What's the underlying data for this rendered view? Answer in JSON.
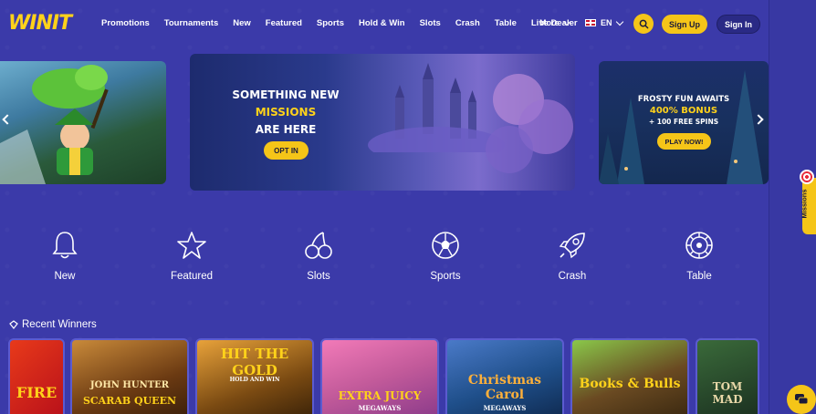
{
  "header": {
    "logo_w": "W",
    "logo_rest": "INIT",
    "nav": [
      "Promotions",
      "Tournaments",
      "New",
      "Featured",
      "Sports",
      "Hold & Win",
      "Slots",
      "Crash",
      "Table",
      "Live Dealer"
    ],
    "more_label": "More",
    "lang_label": "EN",
    "signup_label": "Sign Up",
    "signin_label": "Sign In"
  },
  "banners": {
    "middle": {
      "line1": "SOMETHING NEW",
      "line2": "MISSIONS",
      "line3": "ARE HERE",
      "button": "OPT IN"
    },
    "right": {
      "line1": "FROSTY FUN AWAITS",
      "line2": "400% BONUS",
      "line3": "+ 100 FREE SPINS",
      "button": "PLAY NOW!"
    }
  },
  "categories": [
    "New",
    "Featured",
    "Slots",
    "Sports",
    "Crash",
    "Table"
  ],
  "recent_winners": {
    "title": "Recent Winners",
    "games": [
      {
        "title": "FIRE",
        "color": "#c8161d"
      },
      {
        "title": "JOHN HUNTER",
        "subtitle": "SCARAB QUEEN",
        "color": "#6b3a12"
      },
      {
        "title": "HIT THE GOLD",
        "subtitle": "HOLD AND WIN",
        "color": "#7a4a12"
      },
      {
        "title": "EXTRA JUICY",
        "subtitle": "MEGAWAYS",
        "color": "#c25a9a"
      },
      {
        "title": "Christmas Carol",
        "subtitle": "MEGAWAYS",
        "color": "#1f4f8a"
      },
      {
        "title": "Books & Bulls",
        "color": "#6a4a22"
      },
      {
        "title": "TOM MAD",
        "color": "#1b3020"
      }
    ]
  },
  "side": {
    "missions_label": "Missions"
  },
  "colors": {
    "background": "#3b3aa9",
    "accent": "#f5c518"
  }
}
